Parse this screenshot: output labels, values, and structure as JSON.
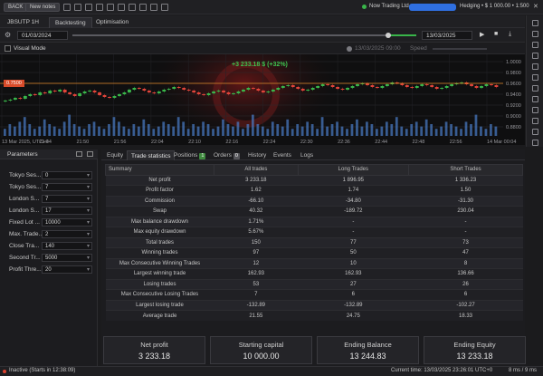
{
  "toolbar": {
    "back_label": "BACK",
    "new_label": "New notes",
    "connection_text": "Now Trading Ltd",
    "account_text": "Hedging • $ 1 000.00 • 1:500"
  },
  "tabs_top": [
    "JBSUTP 1H",
    "Backtesting",
    "Optimisation"
  ],
  "range": {
    "from": "01/03/2024",
    "to": "13/03/2025"
  },
  "visual_mode": {
    "label": "Visual Mode",
    "time": "13/03/2025 09:00",
    "speed_label": "Speed"
  },
  "chart": {
    "price_left": "0.7500",
    "profit_label": "+3 233.18 $ (+32%)",
    "y_ticks": [
      "1.0000",
      "0.9800",
      "0.9600",
      "0.9400",
      "0.9200",
      "0.9000",
      "0.8800"
    ],
    "x_ticks": [
      "13 Mar 2025, UTC+0",
      "21:44",
      "21:50",
      "21:56",
      "22:04",
      "22:10",
      "22:16",
      "22:24",
      "22:30",
      "22:36",
      "22:44",
      "22:48",
      "22:56",
      "14 Mar 00:04"
    ],
    "up_color": "#39b54a",
    "down_color": "#e0443a",
    "prices": [
      0.944,
      0.945,
      0.947,
      0.946,
      0.949,
      0.951,
      0.95,
      0.953,
      0.952,
      0.955,
      0.954,
      0.956,
      0.953,
      0.951,
      0.949,
      0.952,
      0.954,
      0.955,
      0.953,
      0.95,
      0.948,
      0.947,
      0.949,
      0.951,
      0.953,
      0.956,
      0.958,
      0.957,
      0.955,
      0.953,
      0.952,
      0.954,
      0.956,
      0.957,
      0.959,
      0.958,
      0.956,
      0.955,
      0.953,
      0.951,
      0.95,
      0.952,
      0.954,
      0.955,
      0.953,
      0.951,
      0.952,
      0.954,
      0.956,
      0.958,
      0.957,
      0.955,
      0.953,
      0.954,
      0.956,
      0.958,
      0.96,
      0.961,
      0.959,
      0.957,
      0.955,
      0.956,
      0.958,
      0.96,
      0.962,
      0.961,
      0.959,
      0.957,
      0.956,
      0.958,
      0.96,
      0.962,
      0.963,
      0.961,
      0.959,
      0.958,
      0.96,
      0.962,
      0.964,
      0.963,
      0.961,
      0.959,
      0.958,
      0.96,
      0.962,
      0.961,
      0.959,
      0.957,
      0.958,
      0.96,
      0.962,
      0.963,
      0.964,
      0.962,
      0.96,
      0.958,
      0.96,
      0.962,
      0.961,
      0.959
    ],
    "volumes": [
      0.3,
      0.5,
      0.4,
      0.6,
      0.8,
      0.5,
      0.3,
      0.4,
      0.7,
      0.5,
      0.4,
      0.3,
      0.6,
      0.9,
      0.5,
      0.4,
      0.3,
      0.5,
      0.6,
      0.4,
      0.3,
      0.5,
      0.8,
      0.6,
      0.4,
      0.3,
      0.5,
      0.4,
      0.7,
      0.5,
      0.3,
      0.4,
      0.6,
      0.5,
      0.4,
      0.8,
      0.6,
      0.3,
      0.5,
      0.4,
      0.6,
      0.5,
      0.3,
      0.4,
      0.7,
      0.5,
      0.4,
      0.6,
      0.3,
      0.5,
      0.9,
      0.5,
      0.4,
      0.3,
      0.6,
      0.5,
      0.4,
      0.7,
      0.3,
      0.5,
      0.4,
      0.6,
      0.5,
      0.3,
      0.8,
      0.4,
      0.5,
      0.6,
      0.4,
      0.3,
      0.5,
      0.7,
      0.4,
      0.6,
      0.5,
      0.3,
      0.4,
      0.6,
      0.5,
      0.8,
      0.4,
      0.3,
      0.5,
      0.6,
      0.4,
      0.7,
      0.5,
      0.3,
      0.4,
      0.6,
      0.5,
      0.4,
      0.3,
      0.6,
      0.5,
      0.9,
      0.4,
      0.3,
      0.5,
      0.4
    ]
  },
  "parameters": {
    "header": "Parameters",
    "rows": [
      {
        "label": "Tokyo Ses...",
        "value": "0"
      },
      {
        "label": "Tokyo Ses...",
        "value": "7"
      },
      {
        "label": "London S...",
        "value": "7"
      },
      {
        "label": "London S...",
        "value": "17"
      },
      {
        "label": "Fixed Lot ...",
        "value": "10000"
      },
      {
        "label": "Max. Trade...",
        "value": "2"
      },
      {
        "label": "Close Tra...",
        "value": "140"
      },
      {
        "label": "Second Tr...",
        "value": "5000"
      },
      {
        "label": "Profit Thre...",
        "value": "20"
      }
    ]
  },
  "bottom_tabs": [
    {
      "label": "Equity"
    },
    {
      "label": "Trade statistics"
    },
    {
      "label": "Positions",
      "badge": "1"
    },
    {
      "label": "Orders",
      "badge": "0"
    },
    {
      "label": "History"
    },
    {
      "label": "Events"
    },
    {
      "label": "Logs"
    }
  ],
  "stats": {
    "headers": [
      "Summary",
      "All trades",
      "Long Trades",
      "Short Trades"
    ],
    "rows": [
      [
        "Net profit",
        "3 233.18",
        "1 896.95",
        "1 336.23"
      ],
      [
        "Profit factor",
        "1.62",
        "1.74",
        "1.50"
      ],
      [
        "Commission",
        "-66.10",
        "-34.80",
        "-31.30"
      ],
      [
        "Swap",
        "40.32",
        "-189.72",
        "230.04"
      ],
      [
        "Max balance drawdown",
        "1.71%",
        "-",
        "-"
      ],
      [
        "Max equity drawdown",
        "5.67%",
        "-",
        "-"
      ],
      [
        "Total trades",
        "150",
        "77",
        "73"
      ],
      [
        "Winning trades",
        "97",
        "50",
        "47"
      ],
      [
        "Max Consecutive Winning Trades",
        "12",
        "10",
        "8"
      ],
      [
        "Largest winning trade",
        "162.93",
        "162.93",
        "136.66"
      ],
      [
        "Losing trades",
        "53",
        "27",
        "26"
      ],
      [
        "Max Consecutive Losing Trades",
        "7",
        "6",
        "6"
      ],
      [
        "Largest losing trade",
        "-132.89",
        "-132.89",
        "-102.27"
      ],
      [
        "Average trade",
        "21.55",
        "24.75",
        "18.33"
      ]
    ]
  },
  "summary": [
    {
      "title": "Net profit",
      "value": "3 233.18"
    },
    {
      "title": "Starting capital",
      "value": "10 000.00"
    },
    {
      "title": "Ending Balance",
      "value": "13 244.83"
    },
    {
      "title": "Ending Equity",
      "value": "13 233.18"
    }
  ],
  "status": {
    "left": "Inactive (Starts in 12:38:09)",
    "right": "Current time: 13/03/2025 23:26:01 UTC+0",
    "ping": "8 ms / 9 ms"
  }
}
